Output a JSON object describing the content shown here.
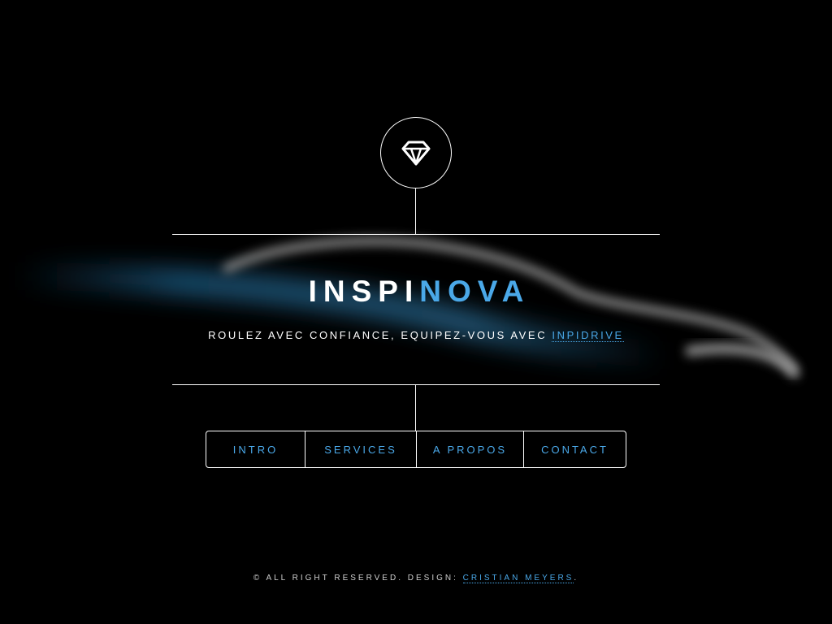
{
  "site": {
    "title_part1": "INSPI",
    "title_part2": "NOVA",
    "tagline_text": "ROULEZ AVEC CONFIANCE, EQUIPEZ-VOUS AVEC ",
    "tagline_link": "INPIDRIVE",
    "logo_icon": "diamond-icon"
  },
  "nav": {
    "items": [
      {
        "label": "INTRO"
      },
      {
        "label": "SERVICES"
      },
      {
        "label": "A PROPOS"
      },
      {
        "label": "CONTACT"
      }
    ]
  },
  "footer": {
    "text": "© ALL RIGHT RESERVED. DESIGN: ",
    "link": "CRISTIAN MEYERS",
    "end": "."
  },
  "colors": {
    "background": "#000000",
    "accent": "#4aa8e8",
    "line": "#ffffff"
  }
}
